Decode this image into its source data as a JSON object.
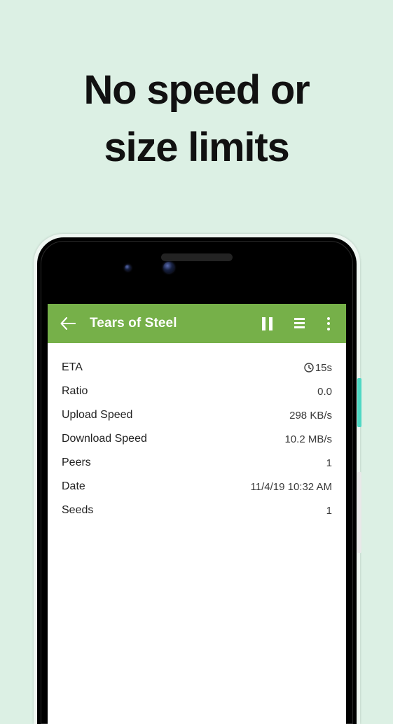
{
  "promo": {
    "headline_line1": "No speed or",
    "headline_line2": "size limits",
    "background_color": "#dcf0e4",
    "text_color": "#111111"
  },
  "device": {
    "power_button_color": "#4fd8c4",
    "volume_button_color": "#e9e9e9",
    "body_color": "#000000"
  },
  "statusbar": {
    "icons": [
      "wifi-icon",
      "cell-signal-icon",
      "battery-icon"
    ]
  },
  "appbar": {
    "back_icon": "arrow-left-icon",
    "title": "Tears of Steel",
    "background_color": "#76b049",
    "actions": [
      {
        "name": "pause-button",
        "icon": "pause-icon",
        "label": "Pause"
      },
      {
        "name": "list-view-button",
        "icon": "list-icon",
        "label": "List"
      },
      {
        "name": "overflow-menu-button",
        "icon": "more-vert-icon",
        "label": "More options"
      }
    ]
  },
  "details": {
    "rows": [
      {
        "label": "ETA",
        "value": "15s",
        "icon": "clock-icon"
      },
      {
        "label": "Ratio",
        "value": "0.0",
        "icon": ""
      },
      {
        "label": "Upload Speed",
        "value": "298 KB/s",
        "icon": ""
      },
      {
        "label": "Download Speed",
        "value": "10.2 MB/s",
        "icon": ""
      },
      {
        "label": "Peers",
        "value": "1",
        "icon": ""
      },
      {
        "label": "Date",
        "value": "11/4/19 10:32 AM",
        "icon": ""
      },
      {
        "label": "Seeds",
        "value": "1",
        "icon": ""
      }
    ]
  }
}
